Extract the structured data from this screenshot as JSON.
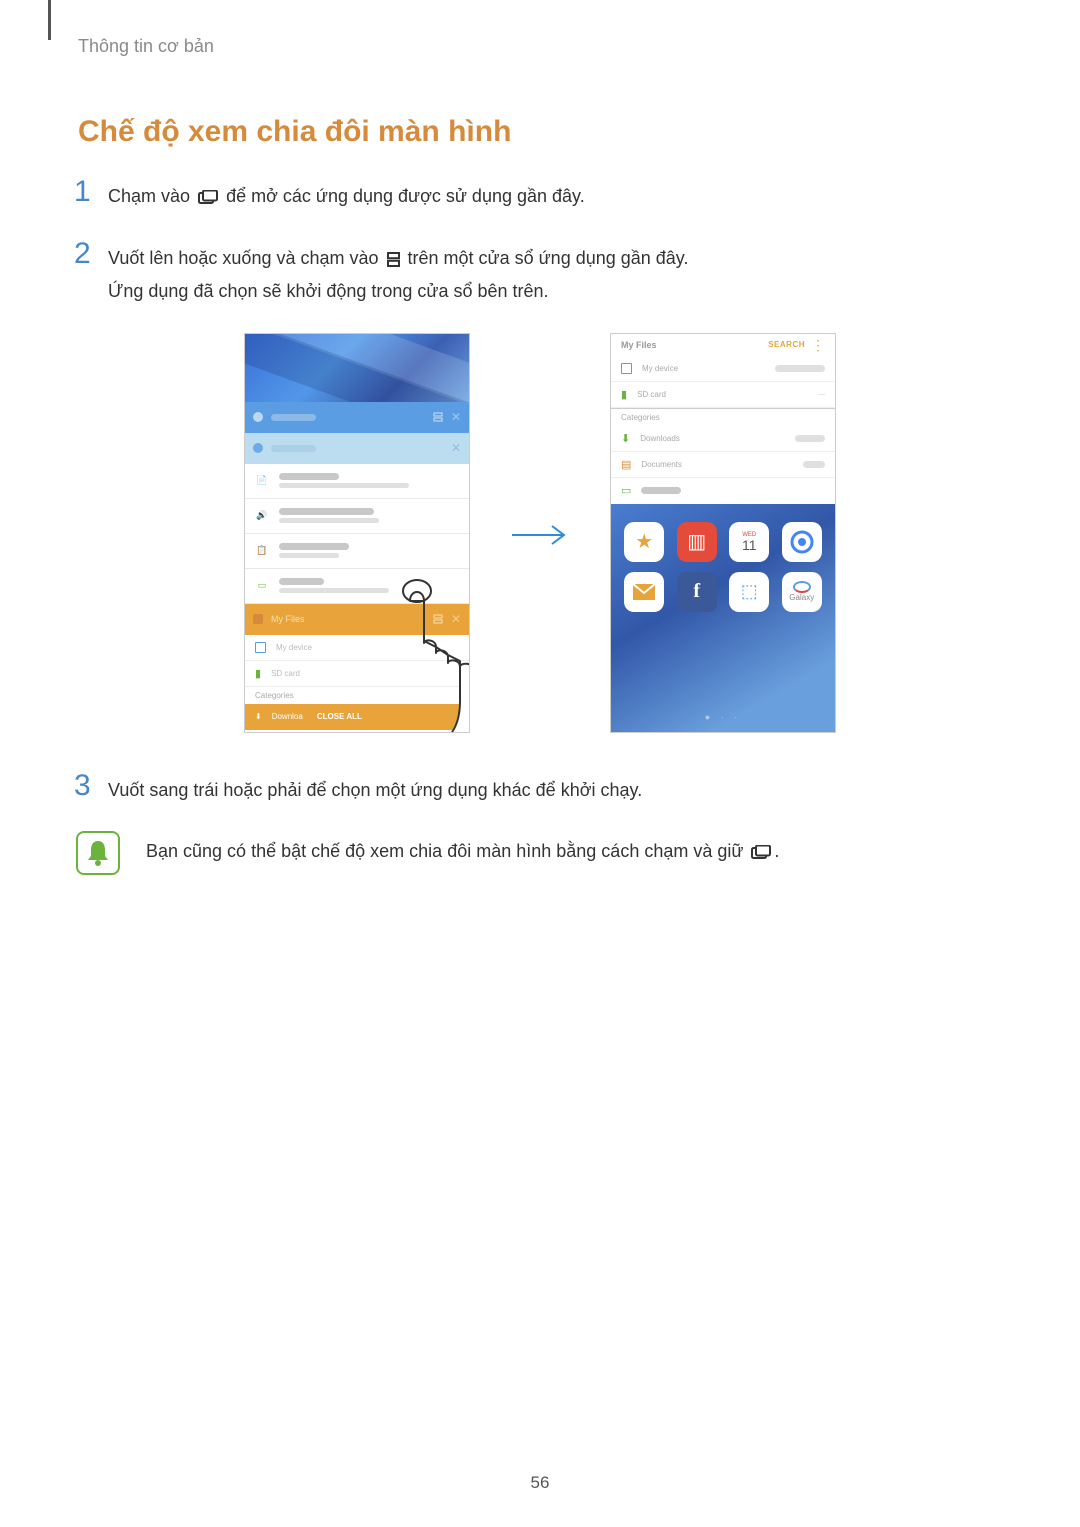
{
  "breadcrumb": "Thông tin cơ bản",
  "heading": "Chế độ xem chia đôi màn hình",
  "steps": {
    "s1": {
      "num": "1",
      "before": "Chạm vào ",
      "after": " để mở các ứng dụng được sử dụng gần đây."
    },
    "s2": {
      "num": "2",
      "l1a": "Vuốt lên hoặc xuống và chạm vào ",
      "l1b": " trên một cửa sổ ứng dụng gần đây.",
      "l2": "Ứng dụng đã chọn sẽ khởi động trong cửa sổ bên trên."
    },
    "s3": {
      "num": "3",
      "text": "Vuốt sang trái hoặc phải để chọn một ứng dụng khác để khởi chạy."
    }
  },
  "tip": {
    "before": "Bạn cũng có thể bật chế độ xem chia đôi màn hình bằng cách chạm và giữ ",
    "after": "."
  },
  "page_number": "56",
  "mock": {
    "left": {
      "myfiles_title": "My Files",
      "mydevice": "My device",
      "sdcard": "SD card",
      "categories": "Categories",
      "download": "Downloa",
      "close_all": "CLOSE ALL"
    },
    "right": {
      "myfiles_title": "My Files",
      "search": "SEARCH",
      "mydevice": "My device",
      "sdcard": "SD card",
      "categories": "Categories",
      "downloads": "Downloads",
      "documents": "Documents",
      "cal_day": "11"
    }
  }
}
